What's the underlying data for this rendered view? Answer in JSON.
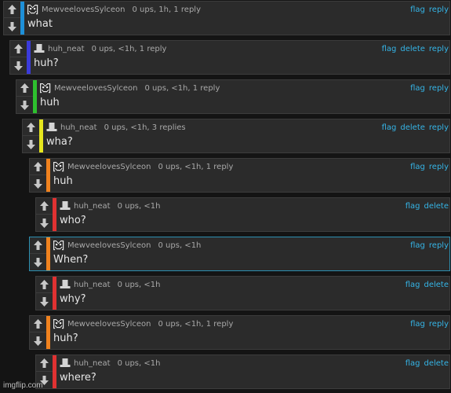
{
  "colors": {
    "background": "#141414",
    "panel": "#2b2b2b",
    "link": "#35b4e6",
    "highlight_border": "#2c8fb0"
  },
  "icons": {
    "upvote": "up-arrow-icon",
    "downvote": "down-arrow-icon",
    "avatar_pixel": "pixel-avatar-icon",
    "avatar_hat": "top-hat-avatar-icon"
  },
  "comments": [
    {
      "author": "MewveelovesSylceon",
      "avatar": "pixel",
      "meta": "0 ups, 1h, 1 reply",
      "text": "what",
      "depth_color": "#1e90d8",
      "actions": [
        "flag",
        "reply"
      ]
    },
    {
      "author": "huh_neat",
      "avatar": "hat",
      "meta": "0 ups, <1h, 1 reply",
      "text": "huh?",
      "depth_color": "#3b3bdb",
      "actions": [
        "flag",
        "delete",
        "reply"
      ]
    },
    {
      "author": "MewveelovesSylceon",
      "avatar": "pixel",
      "meta": "0 ups, <1h, 1 reply",
      "text": "huh",
      "depth_color": "#2ec02e",
      "actions": [
        "flag",
        "reply"
      ]
    },
    {
      "author": "huh_neat",
      "avatar": "hat",
      "meta": "0 ups, <1h, 3 replies",
      "text": "wha?",
      "depth_color": "#e6e61e",
      "actions": [
        "flag",
        "delete",
        "reply"
      ]
    },
    {
      "author": "MewveelovesSylceon",
      "avatar": "pixel",
      "meta": "0 ups, <1h, 1 reply",
      "text": "huh",
      "depth_color": "#f0821e",
      "actions": [
        "flag",
        "reply"
      ]
    },
    {
      "author": "huh_neat",
      "avatar": "hat",
      "meta": "0 ups, <1h",
      "text": "who?",
      "depth_color": "#e03232",
      "actions": [
        "flag",
        "delete"
      ]
    },
    {
      "author": "MewveelovesSylceon",
      "avatar": "pixel",
      "meta": "0 ups, <1h",
      "text": "When?",
      "depth_color": "#f0821e",
      "actions": [
        "flag",
        "reply"
      ],
      "highlight": true
    },
    {
      "author": "huh_neat",
      "avatar": "hat",
      "meta": "0 ups, <1h",
      "text": "why?",
      "depth_color": "#e03232",
      "actions": [
        "flag",
        "delete"
      ]
    },
    {
      "author": "MewveelovesSylceon",
      "avatar": "pixel",
      "meta": "0 ups, <1h, 1 reply",
      "text": "huh?",
      "depth_color": "#f0821e",
      "actions": [
        "flag",
        "reply"
      ]
    },
    {
      "author": "huh_neat",
      "avatar": "hat",
      "meta": "0 ups, <1h",
      "text": "where?",
      "depth_color": "#e03232",
      "actions": [
        "flag",
        "delete"
      ]
    }
  ],
  "watermark": "imgflip.com"
}
